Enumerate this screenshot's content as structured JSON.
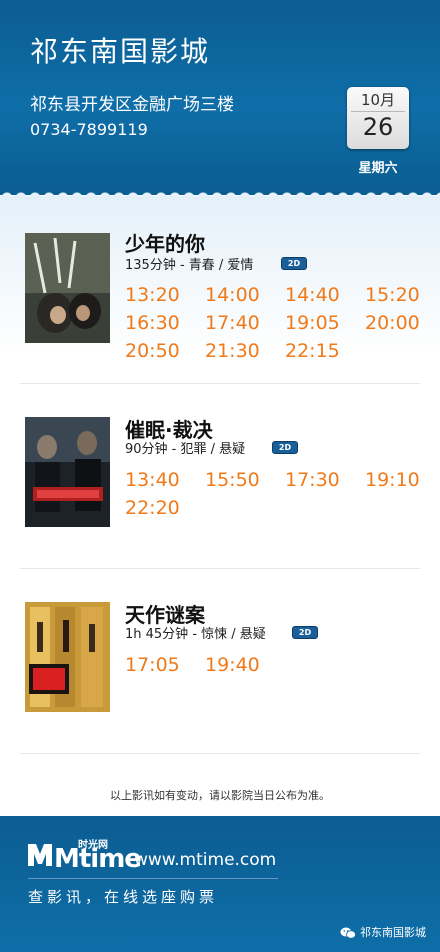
{
  "header": {
    "cinema_name": "祁东南国影城",
    "address": "祁东县开发区金融广场三楼",
    "phone": "0734-7899119",
    "calendar": {
      "month": "10月",
      "day": "26",
      "weekday": "星期六"
    }
  },
  "movies": [
    {
      "title": "少年的你",
      "info": "135分钟 - 青春 / 爱情",
      "format": "2D",
      "times": [
        "13:20",
        "14:00",
        "14:40",
        "15:20",
        "16:30",
        "17:40",
        "19:05",
        "20:00",
        "20:50",
        "21:30",
        "22:15"
      ]
    },
    {
      "title": "催眠·裁决",
      "info": "90分钟 - 犯罪 / 悬疑",
      "format": "2D",
      "times": [
        "13:40",
        "15:50",
        "17:30",
        "19:10",
        "22:20"
      ]
    },
    {
      "title": "天作谜案",
      "info": "1h 45分钟 - 惊悚 / 悬疑",
      "format": "2D",
      "times": [
        "17:05",
        "19:40"
      ]
    }
  ],
  "notice": "以上影讯如有变动，请以影院当日公布为准。",
  "footer": {
    "logo_cn": "时光网",
    "logo": "Mtime",
    "website": "www.mtime.com",
    "slogan": "查影讯，在线选座购票",
    "wechat_account": "祁东南国影城"
  },
  "colors": {
    "header_blue": "#0f6ea8",
    "time_orange": "#f07a1a",
    "badge_blue": "#1b5f9a"
  },
  "icons": [
    "wechat-icon"
  ]
}
